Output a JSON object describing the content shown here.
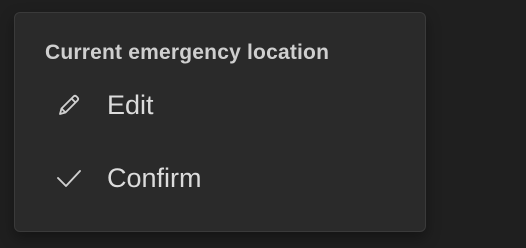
{
  "menu": {
    "title": "Current emergency location",
    "items": [
      {
        "label": "Edit",
        "icon": "pencil-icon"
      },
      {
        "label": "Confirm",
        "icon": "checkmark-icon"
      }
    ]
  },
  "colors": {
    "background": "#1f1f1f",
    "menu_background": "#2a2a2a",
    "text": "#dcdcdc"
  }
}
